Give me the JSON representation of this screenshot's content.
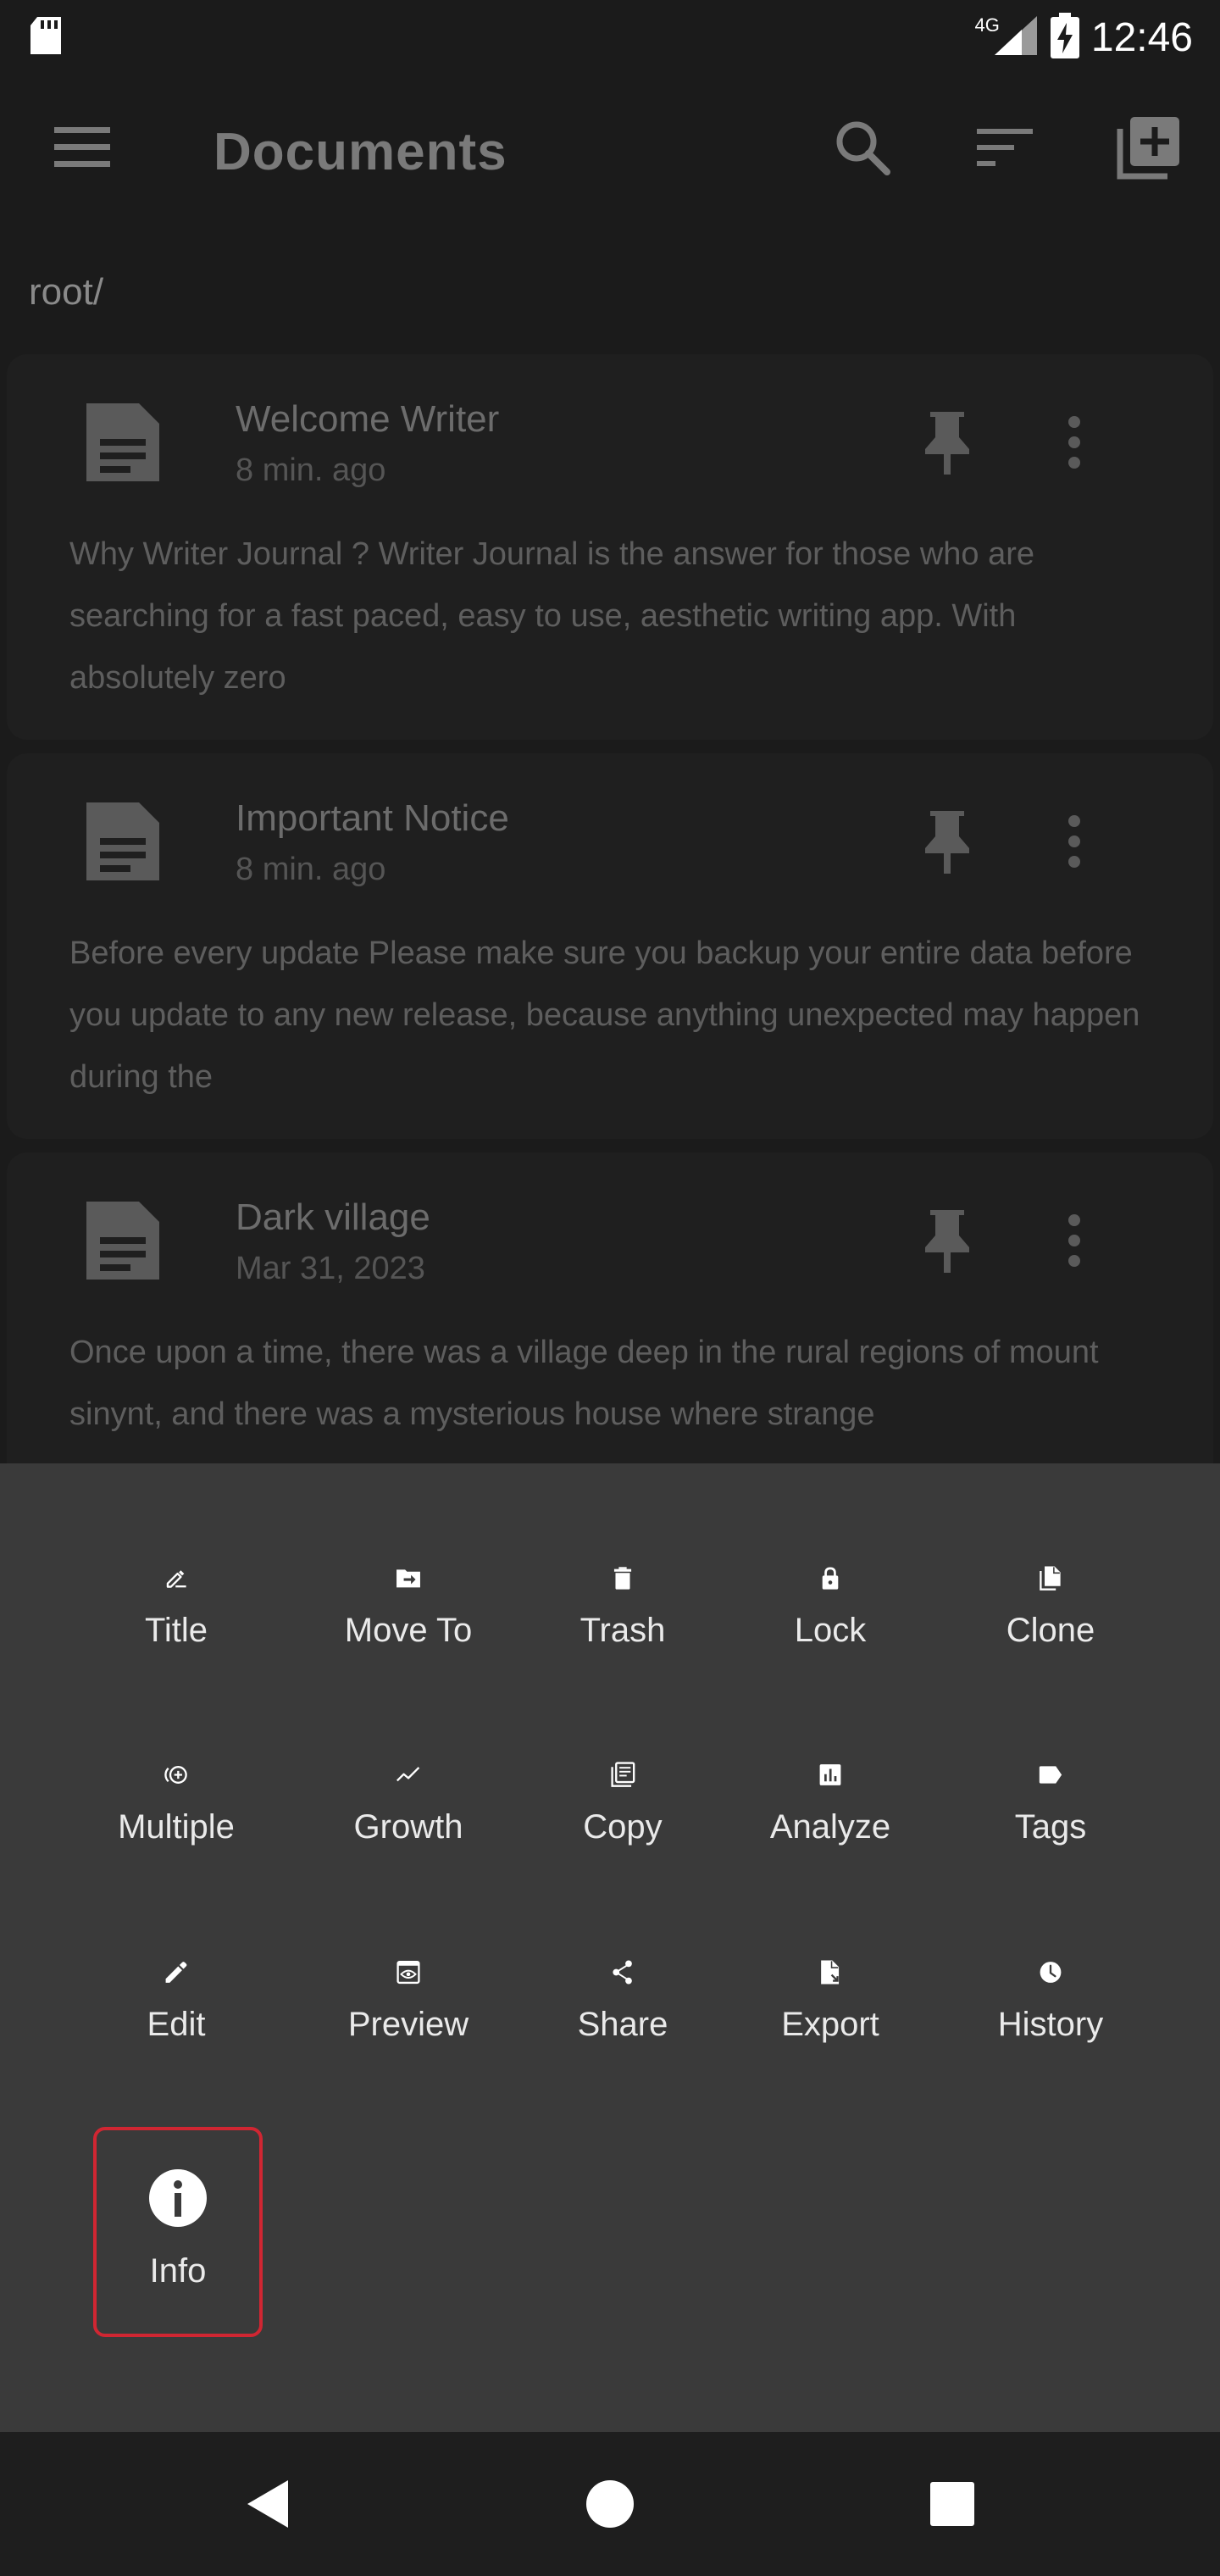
{
  "status_bar": {
    "time": "12:46",
    "network": "4G"
  },
  "app_bar": {
    "title": "Documents"
  },
  "breadcrumb": "root/",
  "documents": [
    {
      "title": "Welcome Writer",
      "date": "8 min. ago",
      "preview": " Why Writer Journal ? Writer Journal is the answer for those who are searching for a fast paced, easy to use, aesthetic writing app. With absolutely zero"
    },
    {
      "title": "Important Notice",
      "date": "8 min. ago",
      "preview": " Before every update Please make sure you backup your entire data before you update to any new release, because anything unexpected may happen during the"
    },
    {
      "title": "Dark village",
      "date": "Mar 31, 2023",
      "preview": " Once upon a time, there was a village deep in the rural regions of mount sinynt, and there was a mysterious house where strange"
    }
  ],
  "actions": [
    {
      "label": "Title",
      "icon": "title-edit-icon"
    },
    {
      "label": "Move To",
      "icon": "move-to-folder-icon"
    },
    {
      "label": "Trash",
      "icon": "trash-icon"
    },
    {
      "label": "Lock",
      "icon": "lock-icon"
    },
    {
      "label": "Clone",
      "icon": "clone-icon"
    },
    {
      "label": "Multiple",
      "icon": "multiple-add-icon"
    },
    {
      "label": "Growth",
      "icon": "growth-icon"
    },
    {
      "label": "Copy",
      "icon": "copy-icon"
    },
    {
      "label": "Analyze",
      "icon": "analyze-icon"
    },
    {
      "label": "Tags",
      "icon": "tag-icon"
    },
    {
      "label": "Edit",
      "icon": "pencil-icon"
    },
    {
      "label": "Preview",
      "icon": "preview-icon"
    },
    {
      "label": "Share",
      "icon": "share-icon"
    },
    {
      "label": "Export",
      "icon": "export-icon"
    },
    {
      "label": "History",
      "icon": "history-icon"
    },
    {
      "label": "Info",
      "icon": "info-icon"
    }
  ],
  "colors": {
    "sheet_bg": "#3a3a3a",
    "highlight": "#d02632"
  }
}
